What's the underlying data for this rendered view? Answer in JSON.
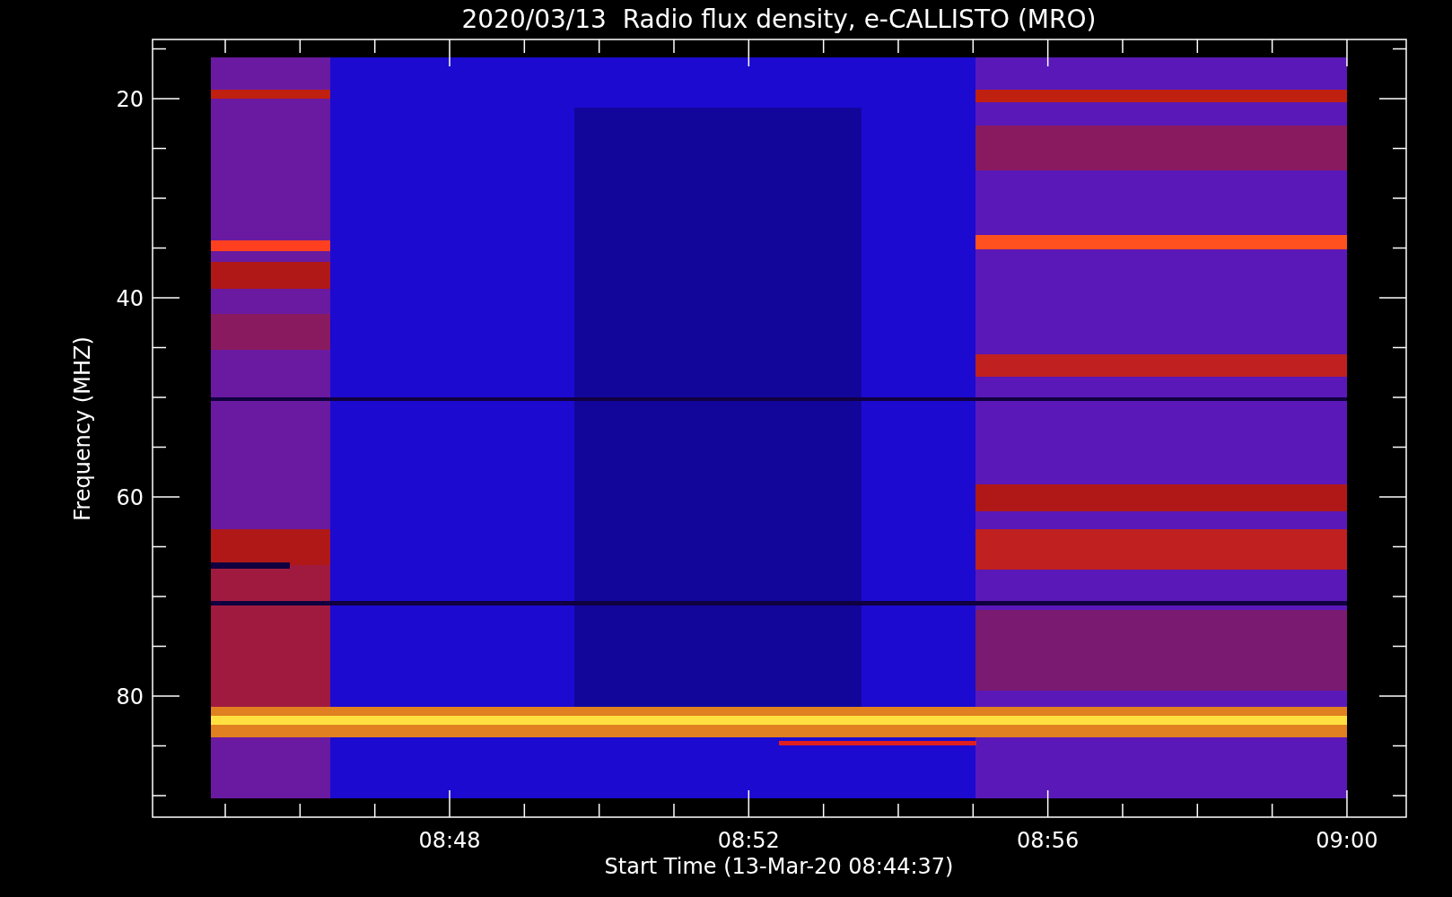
{
  "title": "2020/03/13  Radio flux density, e-CALLISTO (MRO)",
  "y_axis": {
    "label": "Frequency (MHZ)",
    "ticks": [
      "20",
      "40",
      "60",
      "80"
    ]
  },
  "x_axis": {
    "label": "Start Time (13-Mar-20 08:44:37)",
    "ticks": [
      "08:48",
      "08:52",
      "08:56",
      "09:00"
    ]
  }
}
